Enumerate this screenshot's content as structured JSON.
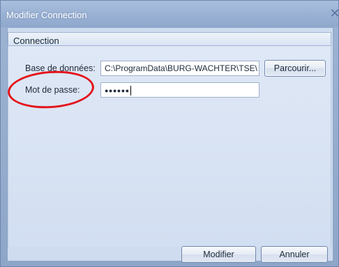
{
  "window": {
    "title": "Modifier Connection",
    "close_symbol": "✕"
  },
  "group": {
    "title": "Connection"
  },
  "database": {
    "label": "Base de données:",
    "value": "C:\\ProgramData\\BURG-WACHTER\\TSE\\",
    "browse_label": "Parcourir..."
  },
  "password": {
    "label": "Mot de passe:",
    "value": "●●●●●●"
  },
  "actions": {
    "modify_label": "Modifier",
    "cancel_label": "Annuler"
  },
  "colors": {
    "annotation": "#e4131b",
    "titlebar": "#9cb3d5",
    "client": "#cfdcef"
  }
}
